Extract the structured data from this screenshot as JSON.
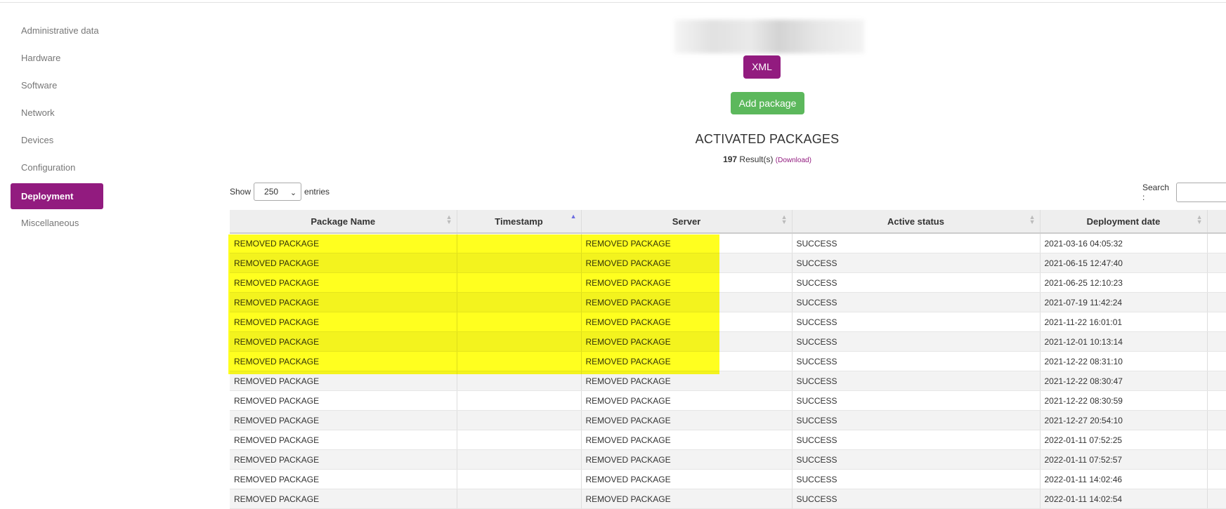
{
  "sidebar": {
    "items": [
      {
        "label": "Administrative data"
      },
      {
        "label": "Hardware"
      },
      {
        "label": "Software"
      },
      {
        "label": "Network"
      },
      {
        "label": "Devices"
      },
      {
        "label": "Configuration"
      },
      {
        "label": "Deployment",
        "active": true
      },
      {
        "label": "Miscellaneous"
      }
    ]
  },
  "header": {
    "xml_label": "XML",
    "add_package_label": "Add package",
    "title": "ACTIVATED PACKAGES",
    "result_count": "197",
    "result_suffix": " Result(s) ",
    "download_label": "(Download)"
  },
  "controls": {
    "show_label": "Show",
    "entries_value": "250",
    "entries_label": "entries",
    "search_label": "Search :"
  },
  "colors": {
    "accent": "#921b7f",
    "success": "#5cb85c",
    "highlight": "#ffff00"
  },
  "table": {
    "columns": [
      "Package Name",
      "Timestamp",
      "Server",
      "Active status",
      "Deployment date"
    ],
    "sorted_column": "Timestamp",
    "rows": [
      {
        "package": "REMOVED PACKAGE",
        "timestamp": "",
        "server": "REMOVED PACKAGE",
        "status": "SUCCESS",
        "date": "2021-03-16 04:05:32"
      },
      {
        "package": "REMOVED PACKAGE",
        "timestamp": "",
        "server": "REMOVED PACKAGE",
        "status": "SUCCESS",
        "date": "2021-06-15 12:47:40"
      },
      {
        "package": "REMOVED PACKAGE",
        "timestamp": "",
        "server": "REMOVED PACKAGE",
        "status": "SUCCESS",
        "date": "2021-06-25 12:10:23"
      },
      {
        "package": "REMOVED PACKAGE",
        "timestamp": "",
        "server": "REMOVED PACKAGE",
        "status": "SUCCESS",
        "date": "2021-07-19 11:42:24"
      },
      {
        "package": "REMOVED PACKAGE",
        "timestamp": "",
        "server": "REMOVED PACKAGE",
        "status": "SUCCESS",
        "date": "2021-11-22 16:01:01"
      },
      {
        "package": "REMOVED PACKAGE",
        "timestamp": "",
        "server": "REMOVED PACKAGE",
        "status": "SUCCESS",
        "date": "2021-12-01 10:13:14"
      },
      {
        "package": "REMOVED PACKAGE",
        "timestamp": "",
        "server": "REMOVED PACKAGE",
        "status": "SUCCESS",
        "date": "2021-12-22 08:31:10"
      },
      {
        "package": "REMOVED PACKAGE",
        "timestamp": "",
        "server": "REMOVED PACKAGE",
        "status": "SUCCESS",
        "date": "2021-12-22 08:30:47"
      },
      {
        "package": "REMOVED PACKAGE",
        "timestamp": "",
        "server": "REMOVED PACKAGE",
        "status": "SUCCESS",
        "date": "2021-12-22 08:30:59"
      },
      {
        "package": "REMOVED PACKAGE",
        "timestamp": "",
        "server": "REMOVED PACKAGE",
        "status": "SUCCESS",
        "date": "2021-12-27 20:54:10"
      },
      {
        "package": "REMOVED PACKAGE",
        "timestamp": "",
        "server": "REMOVED PACKAGE",
        "status": "SUCCESS",
        "date": "2022-01-11 07:52:25"
      },
      {
        "package": "REMOVED PACKAGE",
        "timestamp": "",
        "server": "REMOVED PACKAGE",
        "status": "SUCCESS",
        "date": "2022-01-11 07:52:57"
      },
      {
        "package": "REMOVED PACKAGE",
        "timestamp": "",
        "server": "REMOVED PACKAGE",
        "status": "SUCCESS",
        "date": "2022-01-11 14:02:46"
      },
      {
        "package": "REMOVED PACKAGE",
        "timestamp": "",
        "server": "REMOVED PACKAGE",
        "status": "SUCCESS",
        "date": "2022-01-11 14:02:54"
      }
    ]
  }
}
